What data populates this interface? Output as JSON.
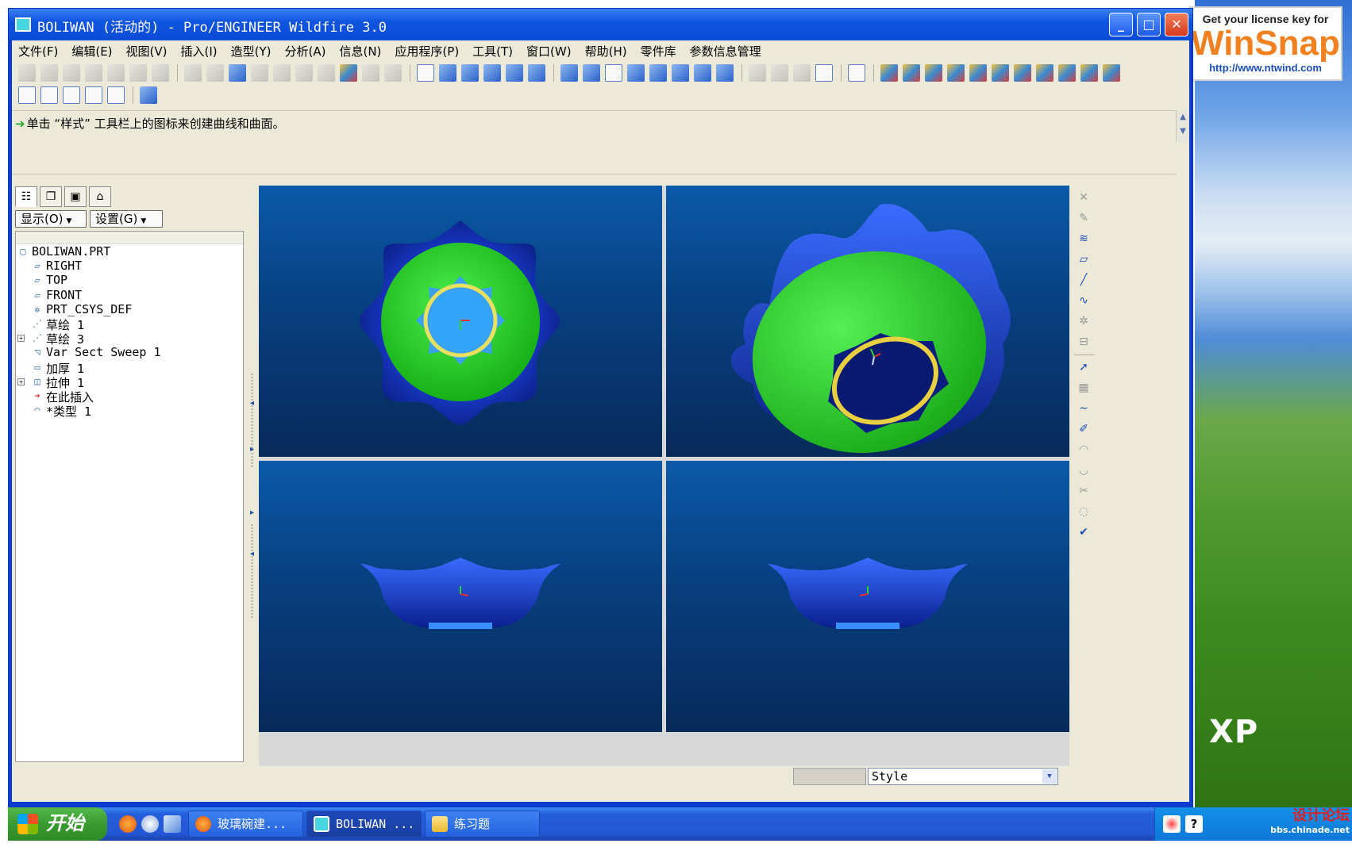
{
  "window": {
    "title": "BOLIWAN (活动的) - Pro/ENGINEER Wildfire 3.0",
    "minimize": "_",
    "maximize": "□",
    "close": "✕"
  },
  "ad": {
    "line1": "Get your license key for",
    "brand": "WinSnap",
    "url": "http://www.ntwind.com"
  },
  "desktop": {
    "os_label": "XP"
  },
  "menu": [
    "文件(F)",
    "编辑(E)",
    "视图(V)",
    "插入(I)",
    "造型(Y)",
    "分析(A)",
    "信息(N)",
    "应用程序(P)",
    "工具(T)",
    "窗口(W)",
    "帮助(H)",
    "零件库",
    "参数信息管理"
  ],
  "message": {
    "text": "单击 “样式” 工具栏上的图标来创建曲线和曲面。"
  },
  "panel": {
    "show_button": "显示(O)",
    "settings_button": "设置(G)",
    "tree": [
      {
        "label": "BOLIWAN.PRT",
        "icon": "part-icon",
        "glyph": "▢",
        "expandable": false,
        "indent": 0
      },
      {
        "label": "RIGHT",
        "icon": "datum-plane-icon",
        "glyph": "▱",
        "expandable": false,
        "indent": 1
      },
      {
        "label": "TOP",
        "icon": "datum-plane-icon",
        "glyph": "▱",
        "expandable": false,
        "indent": 1
      },
      {
        "label": "FRONT",
        "icon": "datum-plane-icon",
        "glyph": "▱",
        "expandable": false,
        "indent": 1
      },
      {
        "label": "PRT_CSYS_DEF",
        "icon": "csys-icon",
        "glyph": "✲",
        "expandable": false,
        "indent": 1
      },
      {
        "label": "草绘 1",
        "icon": "sketch-icon",
        "glyph": "⋰",
        "expandable": false,
        "indent": 1
      },
      {
        "label": "草绘 3",
        "icon": "sketch-icon",
        "glyph": "⋰",
        "expandable": true,
        "indent": 1
      },
      {
        "label": "Var Sect Sweep 1",
        "icon": "sweep-icon",
        "glyph": "◹",
        "expandable": false,
        "indent": 1
      },
      {
        "label": "加厚 1",
        "icon": "thicken-icon",
        "glyph": "▭",
        "expandable": false,
        "indent": 1
      },
      {
        "label": "拉伸 1",
        "icon": "extrude-icon",
        "glyph": "◫",
        "expandable": true,
        "indent": 1
      },
      {
        "label": "在此插入",
        "icon": "insert-here-icon",
        "glyph": "➔",
        "expandable": false,
        "indent": 1
      },
      {
        "label": "*类型 1",
        "icon": "style-icon",
        "glyph": "◠",
        "expandable": false,
        "indent": 1
      }
    ]
  },
  "status": {
    "style_value": "Style"
  },
  "taskbar": {
    "start_label": "开始",
    "tasks": [
      "玻璃碗建...",
      "BOLIWAN ...",
      "练习题"
    ]
  },
  "watermark": {
    "line1": "设计论坛",
    "line2": "bbs.chinade.net"
  },
  "colors": {
    "titlebar": "#0a4bd6",
    "face": "#ece9d8",
    "viewport_top": "#0a5aa8",
    "viewport_bottom": "#072a5a",
    "bowl_green": "#22cc22",
    "bowl_blue": "#1a3cd0",
    "ring_yellow": "#e8e060"
  }
}
